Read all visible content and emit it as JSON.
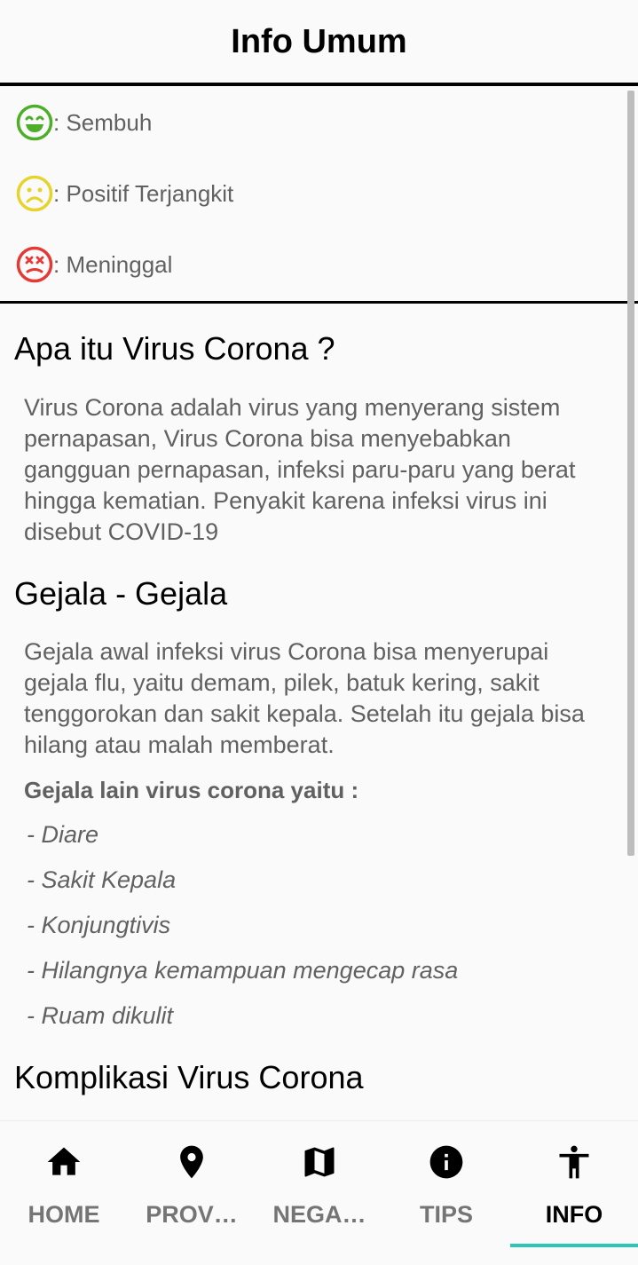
{
  "header": {
    "title": "Info Umum"
  },
  "legend": {
    "items": [
      {
        "label": ": Sembuh",
        "icon": "grin-face-icon",
        "color": "#4caf27"
      },
      {
        "label": ": Positif Terjangkit",
        "icon": "sad-face-icon",
        "color": "#e6d32b"
      },
      {
        "label": " : Meninggal",
        "icon": "dead-face-icon",
        "color": "#e53935"
      }
    ]
  },
  "content": {
    "section1": {
      "heading": "Apa itu Virus Corona ?",
      "body": "Virus Corona adalah virus yang menyerang sistem pernapasan, Virus Corona bisa menyebabkan gangguan pernapasan, infeksi paru-paru yang berat hingga kematian. Penyakit karena infeksi virus ini disebut COVID-19"
    },
    "section2": {
      "heading": "Gejala - Gejala",
      "body": "Gejala awal infeksi virus Corona bisa menyerupai gejala flu, yaitu demam, pilek, batuk kering, sakit tenggorokan dan sakit kepala. Setelah itu gejala bisa hilang atau malah memberat.",
      "subheading": "Gejala lain virus corona yaitu :",
      "list": [
        "- Diare",
        "- Sakit Kepala",
        "- Konjungtivis",
        "- Hilangnya kemampuan mengecap rasa",
        "- Ruam dikulit"
      ]
    },
    "section3": {
      "heading": "Komplikasi Virus Corona"
    }
  },
  "nav": {
    "items": [
      {
        "label": "HOME",
        "icon": "home-icon"
      },
      {
        "label": "PROV…",
        "icon": "location-pin-icon"
      },
      {
        "label": "NEGA…",
        "icon": "map-icon"
      },
      {
        "label": "TIPS",
        "icon": "info-icon"
      },
      {
        "label": "INFO",
        "icon": "accessibility-icon"
      }
    ],
    "active": "INFO",
    "indicator_color": "#2ec4b6"
  }
}
